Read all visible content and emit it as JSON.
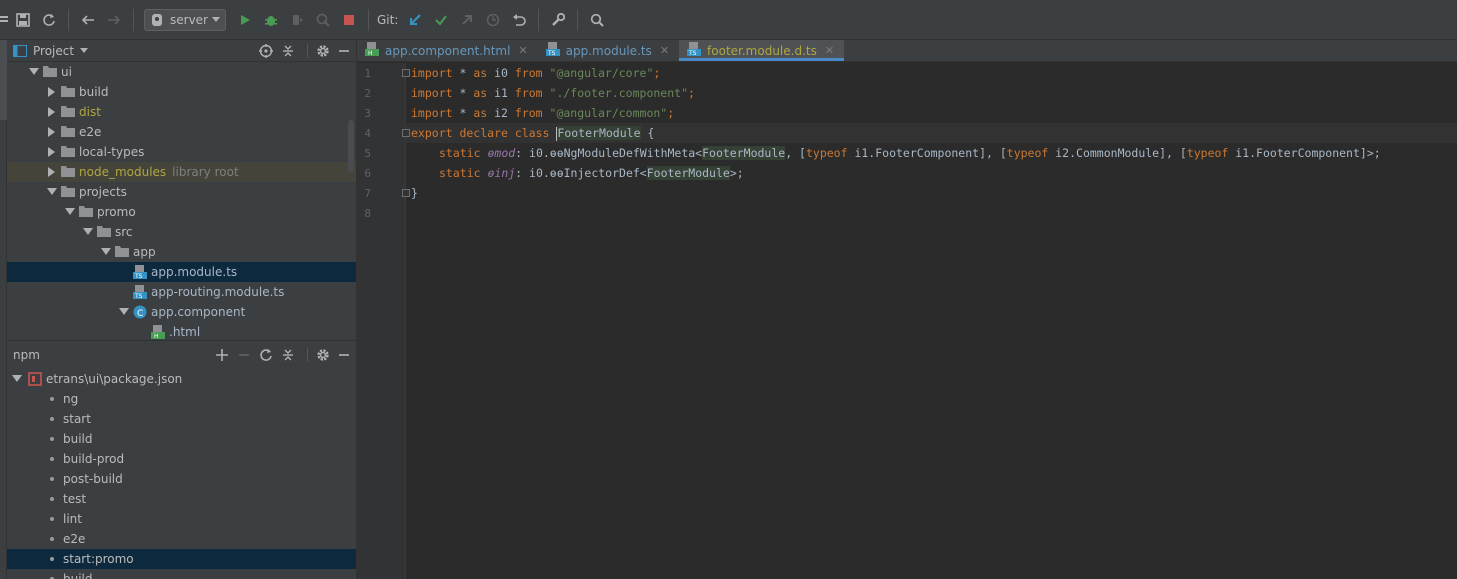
{
  "toolbar": {
    "run_config": "server",
    "git_label": "Git:"
  },
  "project_panel": {
    "title": "Project",
    "tree": [
      {
        "label": "ui",
        "indent": 0,
        "type": "folder",
        "expanded": true
      },
      {
        "label": "build",
        "indent": 1,
        "type": "folder",
        "expanded": false
      },
      {
        "label": "dist",
        "indent": 1,
        "type": "folder",
        "expanded": false,
        "style": "excluded"
      },
      {
        "label": "e2e",
        "indent": 1,
        "type": "folder",
        "expanded": false
      },
      {
        "label": "local-types",
        "indent": 1,
        "type": "folder",
        "expanded": false
      },
      {
        "label": "node_modules",
        "indent": 1,
        "type": "folder",
        "expanded": false,
        "style": "excluded",
        "suffix": "library root"
      },
      {
        "label": "projects",
        "indent": 1,
        "type": "folder",
        "expanded": true
      },
      {
        "label": "promo",
        "indent": 2,
        "type": "folder",
        "expanded": true
      },
      {
        "label": "src",
        "indent": 3,
        "type": "folder",
        "expanded": true
      },
      {
        "label": "app",
        "indent": 4,
        "type": "folder",
        "expanded": true
      },
      {
        "label": "app.module.ts",
        "indent": 5,
        "type": "ts",
        "selected": true
      },
      {
        "label": "app-routing.module.ts",
        "indent": 5,
        "type": "ts"
      },
      {
        "label": "app.component",
        "indent": 5,
        "type": "component",
        "expanded": true
      },
      {
        "label": ".html",
        "indent": 6,
        "type": "html",
        "style": "blue"
      }
    ]
  },
  "npm_panel": {
    "title": "npm",
    "package": "etrans\\ui\\package.json",
    "scripts": [
      "ng",
      "start",
      "build",
      "build-prod",
      "post-build",
      "test",
      "lint",
      "e2e",
      "start:promo",
      "build"
    ],
    "selected_index": 8
  },
  "editor": {
    "tabs": [
      {
        "label": "app.component.html",
        "icon": "html",
        "style": "blue"
      },
      {
        "label": "app.module.ts",
        "icon": "ts",
        "style": "blue"
      },
      {
        "label": "footer.module.d.ts",
        "icon": "ts",
        "style": "mod",
        "active": true
      }
    ],
    "line_numbers": [
      "1",
      "2",
      "3",
      "4",
      "5",
      "6",
      "7",
      "8"
    ],
    "code": {
      "l1": {
        "kw1": "import",
        "plain1": " * ",
        "kw2": "as",
        "plain2": " i0 ",
        "kw3": "from",
        "str": " \"@angular/core\"",
        "end": ";"
      },
      "l2": {
        "kw1": "import",
        "plain1": " * ",
        "kw2": "as",
        "plain2": " i1 ",
        "kw3": "from",
        "str": " \"./footer.component\"",
        "end": ";"
      },
      "l3": {
        "kw1": "import",
        "plain1": " * ",
        "kw2": "as",
        "plain2": " i2 ",
        "kw3": "from",
        "str": " \"@angular/common\"",
        "end": ";"
      },
      "l4": {
        "kw": "export declare class ",
        "name": "FooterModule",
        "end": " {"
      },
      "l5": {
        "kw": "static ",
        "field": "ɵmod",
        "p1": ": i0.ɵɵNgModuleDefWithMeta<",
        "n1": "FooterModule",
        "p2": ", [",
        "t1": "typeof",
        "p3": " i1.FooterComponent], [",
        "t2": "typeof",
        "p4": " i2.CommonModule], [",
        "t3": "typeof",
        "p5": " i1.FooterComponent]>;"
      },
      "l6": {
        "kw": "static ",
        "field": "ɵinj",
        "p1": ": i0.ɵɵInjectorDef<",
        "n1": "FooterModule",
        "p2": ">;"
      },
      "l7": {
        "brace": "}"
      }
    }
  },
  "colors": {
    "keyword": "#cc7832",
    "string": "#6a8759",
    "field": "#9876aa",
    "text": "#a9b7c6",
    "selection": "#0d293e",
    "active_tab_underline": "#4a88c7"
  }
}
